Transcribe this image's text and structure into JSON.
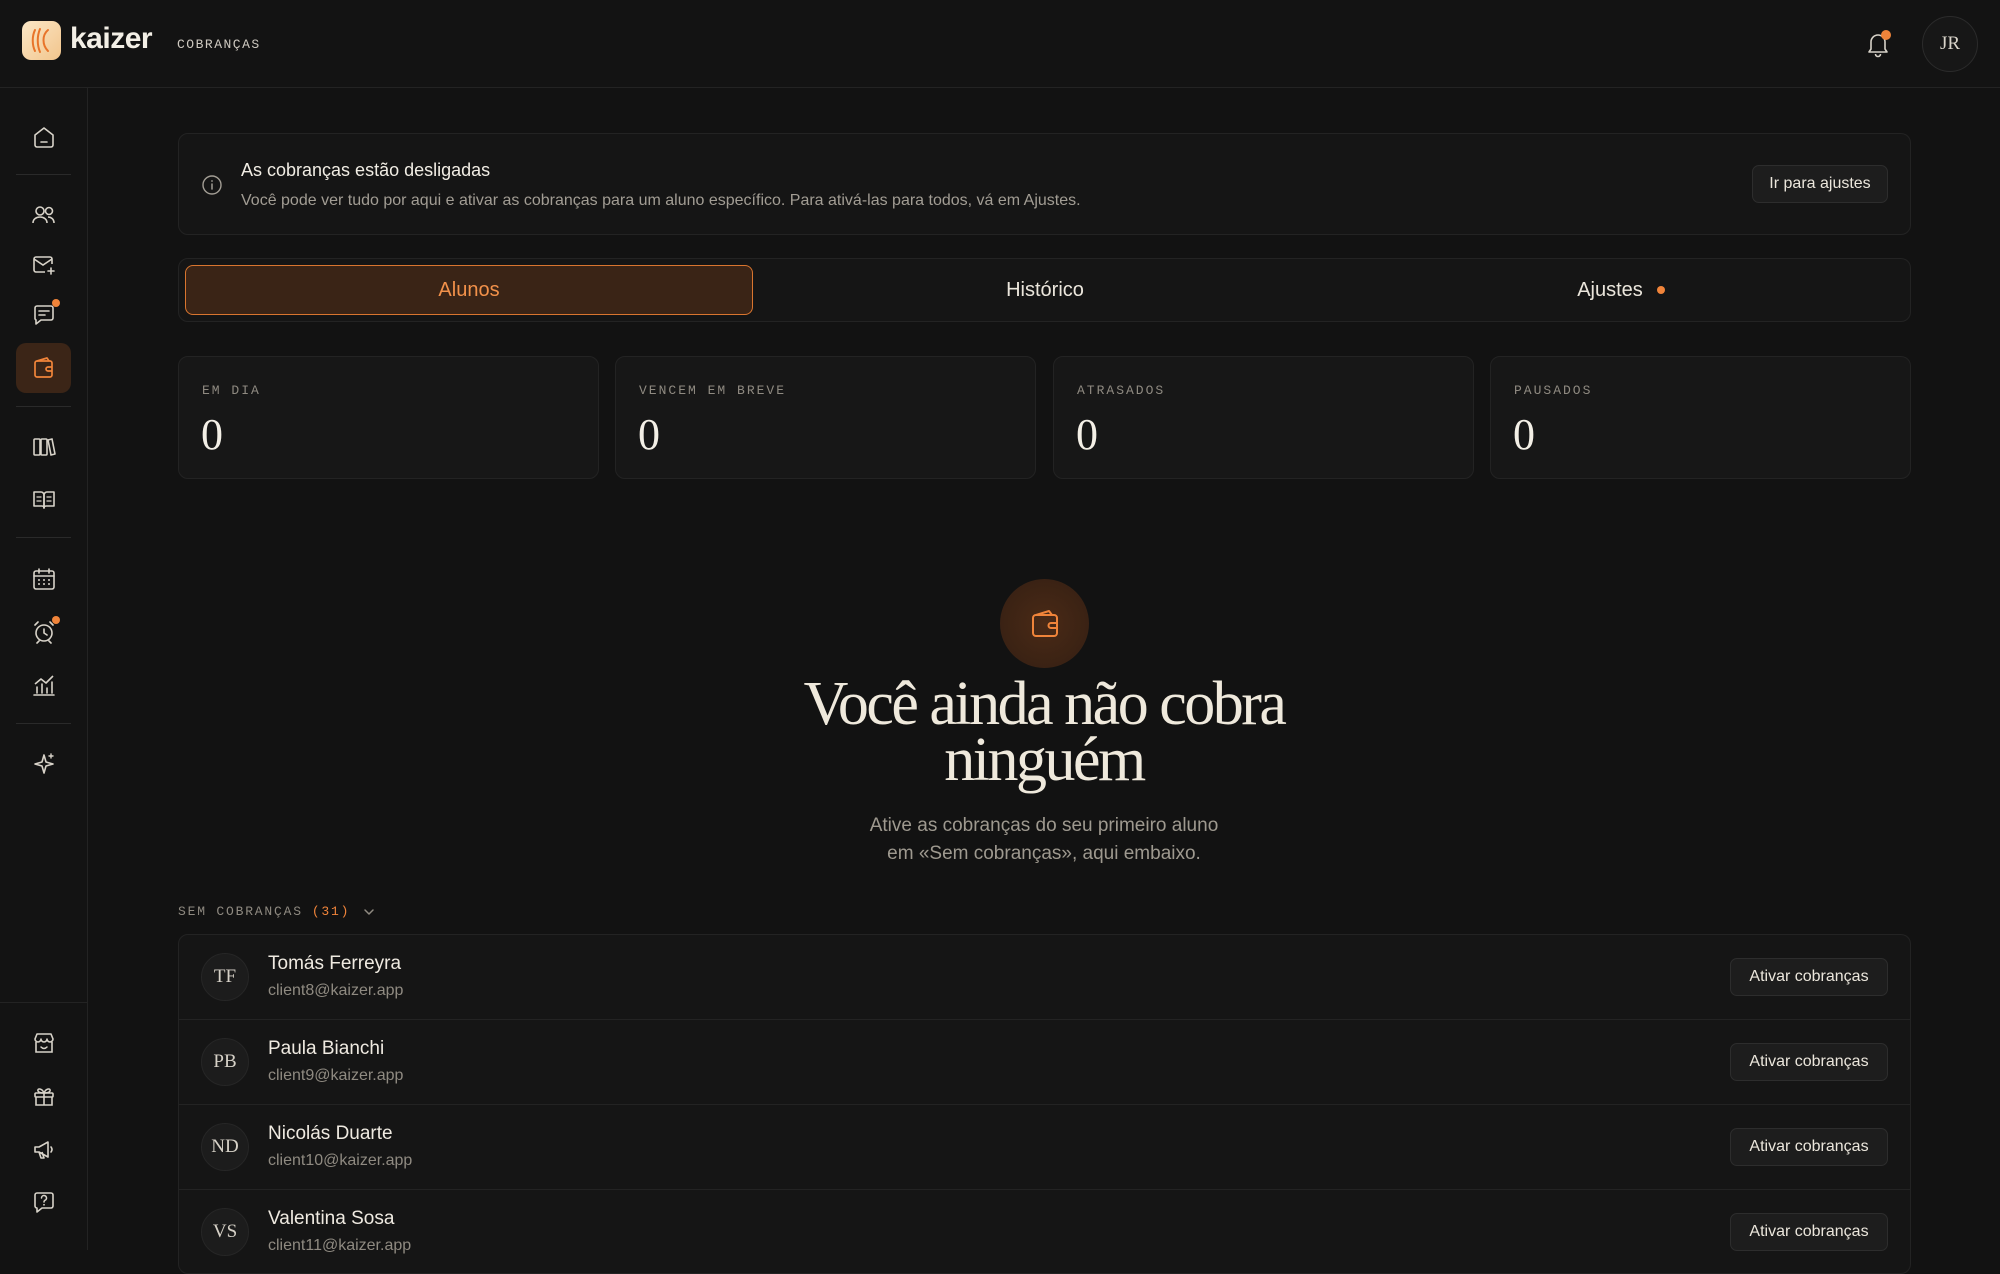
{
  "app": {
    "name": "kaizer",
    "breadcrumb": "COBRANÇAS",
    "user_initials": "JR",
    "accent": "#f0843a"
  },
  "sidebar": {
    "items": [
      {
        "icon": "home-icon"
      },
      {
        "icon": "users-icon"
      },
      {
        "icon": "mail-add-icon"
      },
      {
        "icon": "chat-icon",
        "badge": true
      },
      {
        "icon": "wallet-icon",
        "active": true
      },
      {
        "icon": "library-icon"
      },
      {
        "icon": "book-icon"
      },
      {
        "icon": "calendar-icon"
      },
      {
        "icon": "alarm-icon",
        "badge": true
      },
      {
        "icon": "analytics-icon"
      },
      {
        "icon": "sparkle-icon"
      }
    ],
    "bottom_items": [
      {
        "icon": "store-icon"
      },
      {
        "icon": "gift-icon"
      },
      {
        "icon": "megaphone-icon"
      },
      {
        "icon": "help-icon"
      }
    ]
  },
  "banner": {
    "title": "As cobranças estão desligadas",
    "text": "Você pode ver tudo por aqui e ativar as cobranças para um aluno específico. Para ativá-las para todos, vá em Ajustes.",
    "button": "Ir para ajustes"
  },
  "tabs": [
    {
      "label": "Alunos",
      "active": true
    },
    {
      "label": "Histórico"
    },
    {
      "label": "Ajustes",
      "dot": true
    }
  ],
  "stats": [
    {
      "label": "EM DIA",
      "value": "0"
    },
    {
      "label": "VENCEM EM BREVE",
      "value": "0"
    },
    {
      "label": "ATRASADOS",
      "value": "0"
    },
    {
      "label": "PAUSADOS",
      "value": "0"
    }
  ],
  "empty_state": {
    "title_line1": "Você ainda não cobra",
    "title_line2": "ninguém",
    "subtitle_line1": "Ative as cobranças do seu primeiro aluno",
    "subtitle_line2": "em «Sem cobranças», aqui embaixo."
  },
  "section": {
    "label": "SEM COBRANÇAS",
    "count": "(31)"
  },
  "clients": [
    {
      "initials": "TF",
      "name": "Tomás Ferreyra",
      "email": "client8@kaizer.app",
      "action": "Ativar cobranças"
    },
    {
      "initials": "PB",
      "name": "Paula Bianchi",
      "email": "client9@kaizer.app",
      "action": "Ativar cobranças"
    },
    {
      "initials": "ND",
      "name": "Nicolás Duarte",
      "email": "client10@kaizer.app",
      "action": "Ativar cobranças"
    },
    {
      "initials": "VS",
      "name": "Valentina Sosa",
      "email": "client11@kaizer.app",
      "action": "Ativar cobranças"
    }
  ]
}
